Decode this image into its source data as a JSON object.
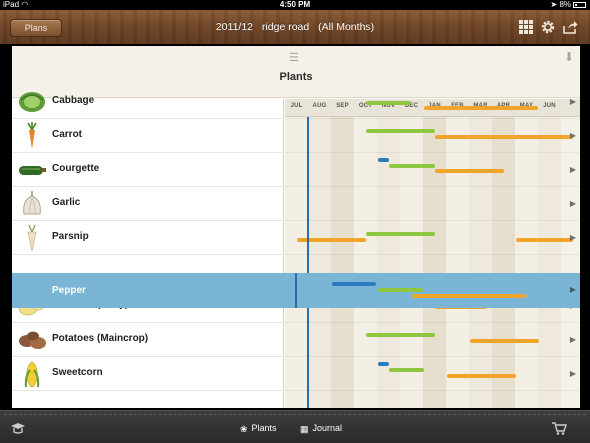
{
  "status": {
    "device": "iPad",
    "time": "4:50 PM",
    "battery": "8%"
  },
  "toolbar": {
    "plans_label": "Plans",
    "season": "2011/12",
    "plot": "ridge road",
    "filter": "(All Months)"
  },
  "panel": {
    "title": "Plants"
  },
  "months": [
    "JUL",
    "AUG",
    "SEP",
    "OCT",
    "NOV",
    "DEC",
    "JAN",
    "FEB",
    "MAR",
    "APR",
    "MAY",
    "JUN"
  ],
  "plants": [
    {
      "name": "Cabbage",
      "icon": "cabbage-icon"
    },
    {
      "name": "Carrot",
      "icon": "carrot-icon"
    },
    {
      "name": "Courgette",
      "icon": "courgette-icon"
    },
    {
      "name": "Garlic",
      "icon": "garlic-icon"
    },
    {
      "name": "Parsnip",
      "icon": "parsnip-icon"
    },
    {
      "name": "Pepper",
      "icon": "pepper-icon",
      "selected": true
    },
    {
      "name": "Potatoes (Early)",
      "icon": "potato-early-icon"
    },
    {
      "name": "Potatoes (Maincrop)",
      "icon": "potato-maincrop-icon"
    },
    {
      "name": "Sweetcorn",
      "icon": "sweetcorn-icon"
    }
  ],
  "tabs": {
    "plants": "Plants",
    "journal": "Journal"
  },
  "colors": {
    "sow": "#8fc63f",
    "harvest": "#f2a42a",
    "indoor": "#2a7cc0",
    "selection": "#7ab5d6"
  }
}
